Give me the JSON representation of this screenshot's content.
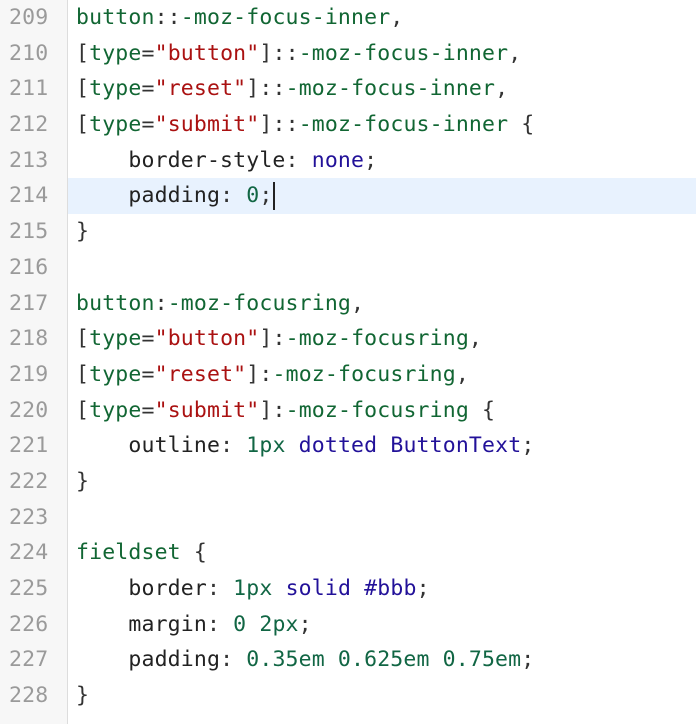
{
  "editor": {
    "language": "css",
    "active_line": 214,
    "cursor_line": 214,
    "lines": [
      {
        "num": "209",
        "tokens": [
          [
            "sel",
            "button"
          ],
          [
            "op",
            "::"
          ],
          [
            "sel",
            "-moz-focus-inner"
          ],
          [
            "pn",
            ","
          ]
        ]
      },
      {
        "num": "210",
        "tokens": [
          [
            "brk",
            "["
          ],
          [
            "sel",
            "type"
          ],
          [
            "op",
            "="
          ],
          [
            "str",
            "\"button\""
          ],
          [
            "brk",
            "]"
          ],
          [
            "op",
            "::"
          ],
          [
            "sel",
            "-moz-focus-inner"
          ],
          [
            "pn",
            ","
          ]
        ]
      },
      {
        "num": "211",
        "tokens": [
          [
            "brk",
            "["
          ],
          [
            "sel",
            "type"
          ],
          [
            "op",
            "="
          ],
          [
            "str",
            "\"reset\""
          ],
          [
            "brk",
            "]"
          ],
          [
            "op",
            "::"
          ],
          [
            "sel",
            "-moz-focus-inner"
          ],
          [
            "pn",
            ","
          ]
        ]
      },
      {
        "num": "212",
        "tokens": [
          [
            "brk",
            "["
          ],
          [
            "sel",
            "type"
          ],
          [
            "op",
            "="
          ],
          [
            "str",
            "\"submit\""
          ],
          [
            "brk",
            "]"
          ],
          [
            "op",
            "::"
          ],
          [
            "sel",
            "-moz-focus-inner"
          ],
          [
            "pn",
            " {"
          ]
        ]
      },
      {
        "num": "213",
        "tokens": [
          [
            "ind",
            "    "
          ],
          [
            "prop",
            "border-style"
          ],
          [
            "pn",
            ": "
          ],
          [
            "kw",
            "none"
          ],
          [
            "pn",
            ";"
          ]
        ]
      },
      {
        "num": "214",
        "tokens": [
          [
            "ind",
            "    "
          ],
          [
            "prop",
            "padding"
          ],
          [
            "pn",
            ": "
          ],
          [
            "num",
            "0"
          ],
          [
            "pn",
            ";"
          ]
        ]
      },
      {
        "num": "215",
        "tokens": [
          [
            "pn",
            "}"
          ]
        ]
      },
      {
        "num": "216",
        "tokens": []
      },
      {
        "num": "217",
        "tokens": [
          [
            "sel",
            "button"
          ],
          [
            "op",
            ":"
          ],
          [
            "sel",
            "-moz-focusring"
          ],
          [
            "pn",
            ","
          ]
        ]
      },
      {
        "num": "218",
        "tokens": [
          [
            "brk",
            "["
          ],
          [
            "sel",
            "type"
          ],
          [
            "op",
            "="
          ],
          [
            "str",
            "\"button\""
          ],
          [
            "brk",
            "]"
          ],
          [
            "op",
            ":"
          ],
          [
            "sel",
            "-moz-focusring"
          ],
          [
            "pn",
            ","
          ]
        ]
      },
      {
        "num": "219",
        "tokens": [
          [
            "brk",
            "["
          ],
          [
            "sel",
            "type"
          ],
          [
            "op",
            "="
          ],
          [
            "str",
            "\"reset\""
          ],
          [
            "brk",
            "]"
          ],
          [
            "op",
            ":"
          ],
          [
            "sel",
            "-moz-focusring"
          ],
          [
            "pn",
            ","
          ]
        ]
      },
      {
        "num": "220",
        "tokens": [
          [
            "brk",
            "["
          ],
          [
            "sel",
            "type"
          ],
          [
            "op",
            "="
          ],
          [
            "str",
            "\"submit\""
          ],
          [
            "brk",
            "]"
          ],
          [
            "op",
            ":"
          ],
          [
            "sel",
            "-moz-focusring"
          ],
          [
            "pn",
            " {"
          ]
        ]
      },
      {
        "num": "221",
        "tokens": [
          [
            "ind",
            "    "
          ],
          [
            "prop",
            "outline"
          ],
          [
            "pn",
            ": "
          ],
          [
            "num",
            "1px"
          ],
          [
            "pn",
            " "
          ],
          [
            "kw",
            "dotted"
          ],
          [
            "pn",
            " "
          ],
          [
            "kw",
            "ButtonText"
          ],
          [
            "pn",
            ";"
          ]
        ]
      },
      {
        "num": "222",
        "tokens": [
          [
            "pn",
            "}"
          ]
        ]
      },
      {
        "num": "223",
        "tokens": []
      },
      {
        "num": "224",
        "tokens": [
          [
            "sel",
            "fieldset"
          ],
          [
            "pn",
            " {"
          ]
        ]
      },
      {
        "num": "225",
        "tokens": [
          [
            "ind",
            "    "
          ],
          [
            "prop",
            "border"
          ],
          [
            "pn",
            ": "
          ],
          [
            "num",
            "1px"
          ],
          [
            "pn",
            " "
          ],
          [
            "kw",
            "solid"
          ],
          [
            "pn",
            " "
          ],
          [
            "kw",
            "#bbb"
          ],
          [
            "pn",
            ";"
          ]
        ]
      },
      {
        "num": "226",
        "tokens": [
          [
            "ind",
            "    "
          ],
          [
            "prop",
            "margin"
          ],
          [
            "pn",
            ": "
          ],
          [
            "num",
            "0 2px"
          ],
          [
            "pn",
            ";"
          ]
        ]
      },
      {
        "num": "227",
        "tokens": [
          [
            "ind",
            "    "
          ],
          [
            "prop",
            "padding"
          ],
          [
            "pn",
            ": "
          ],
          [
            "num",
            "0.35em 0.625em 0.75em"
          ],
          [
            "pn",
            ";"
          ]
        ]
      },
      {
        "num": "228",
        "tokens": [
          [
            "pn",
            "}"
          ]
        ]
      }
    ]
  },
  "colors": {
    "gutter_bg": "#f7f7f7",
    "active_line_bg": "#e8f2fe",
    "selector": "#116633",
    "string": "#aa1111",
    "number": "#116644",
    "keyword": "#221199",
    "line_number": "#9a9a9a"
  }
}
